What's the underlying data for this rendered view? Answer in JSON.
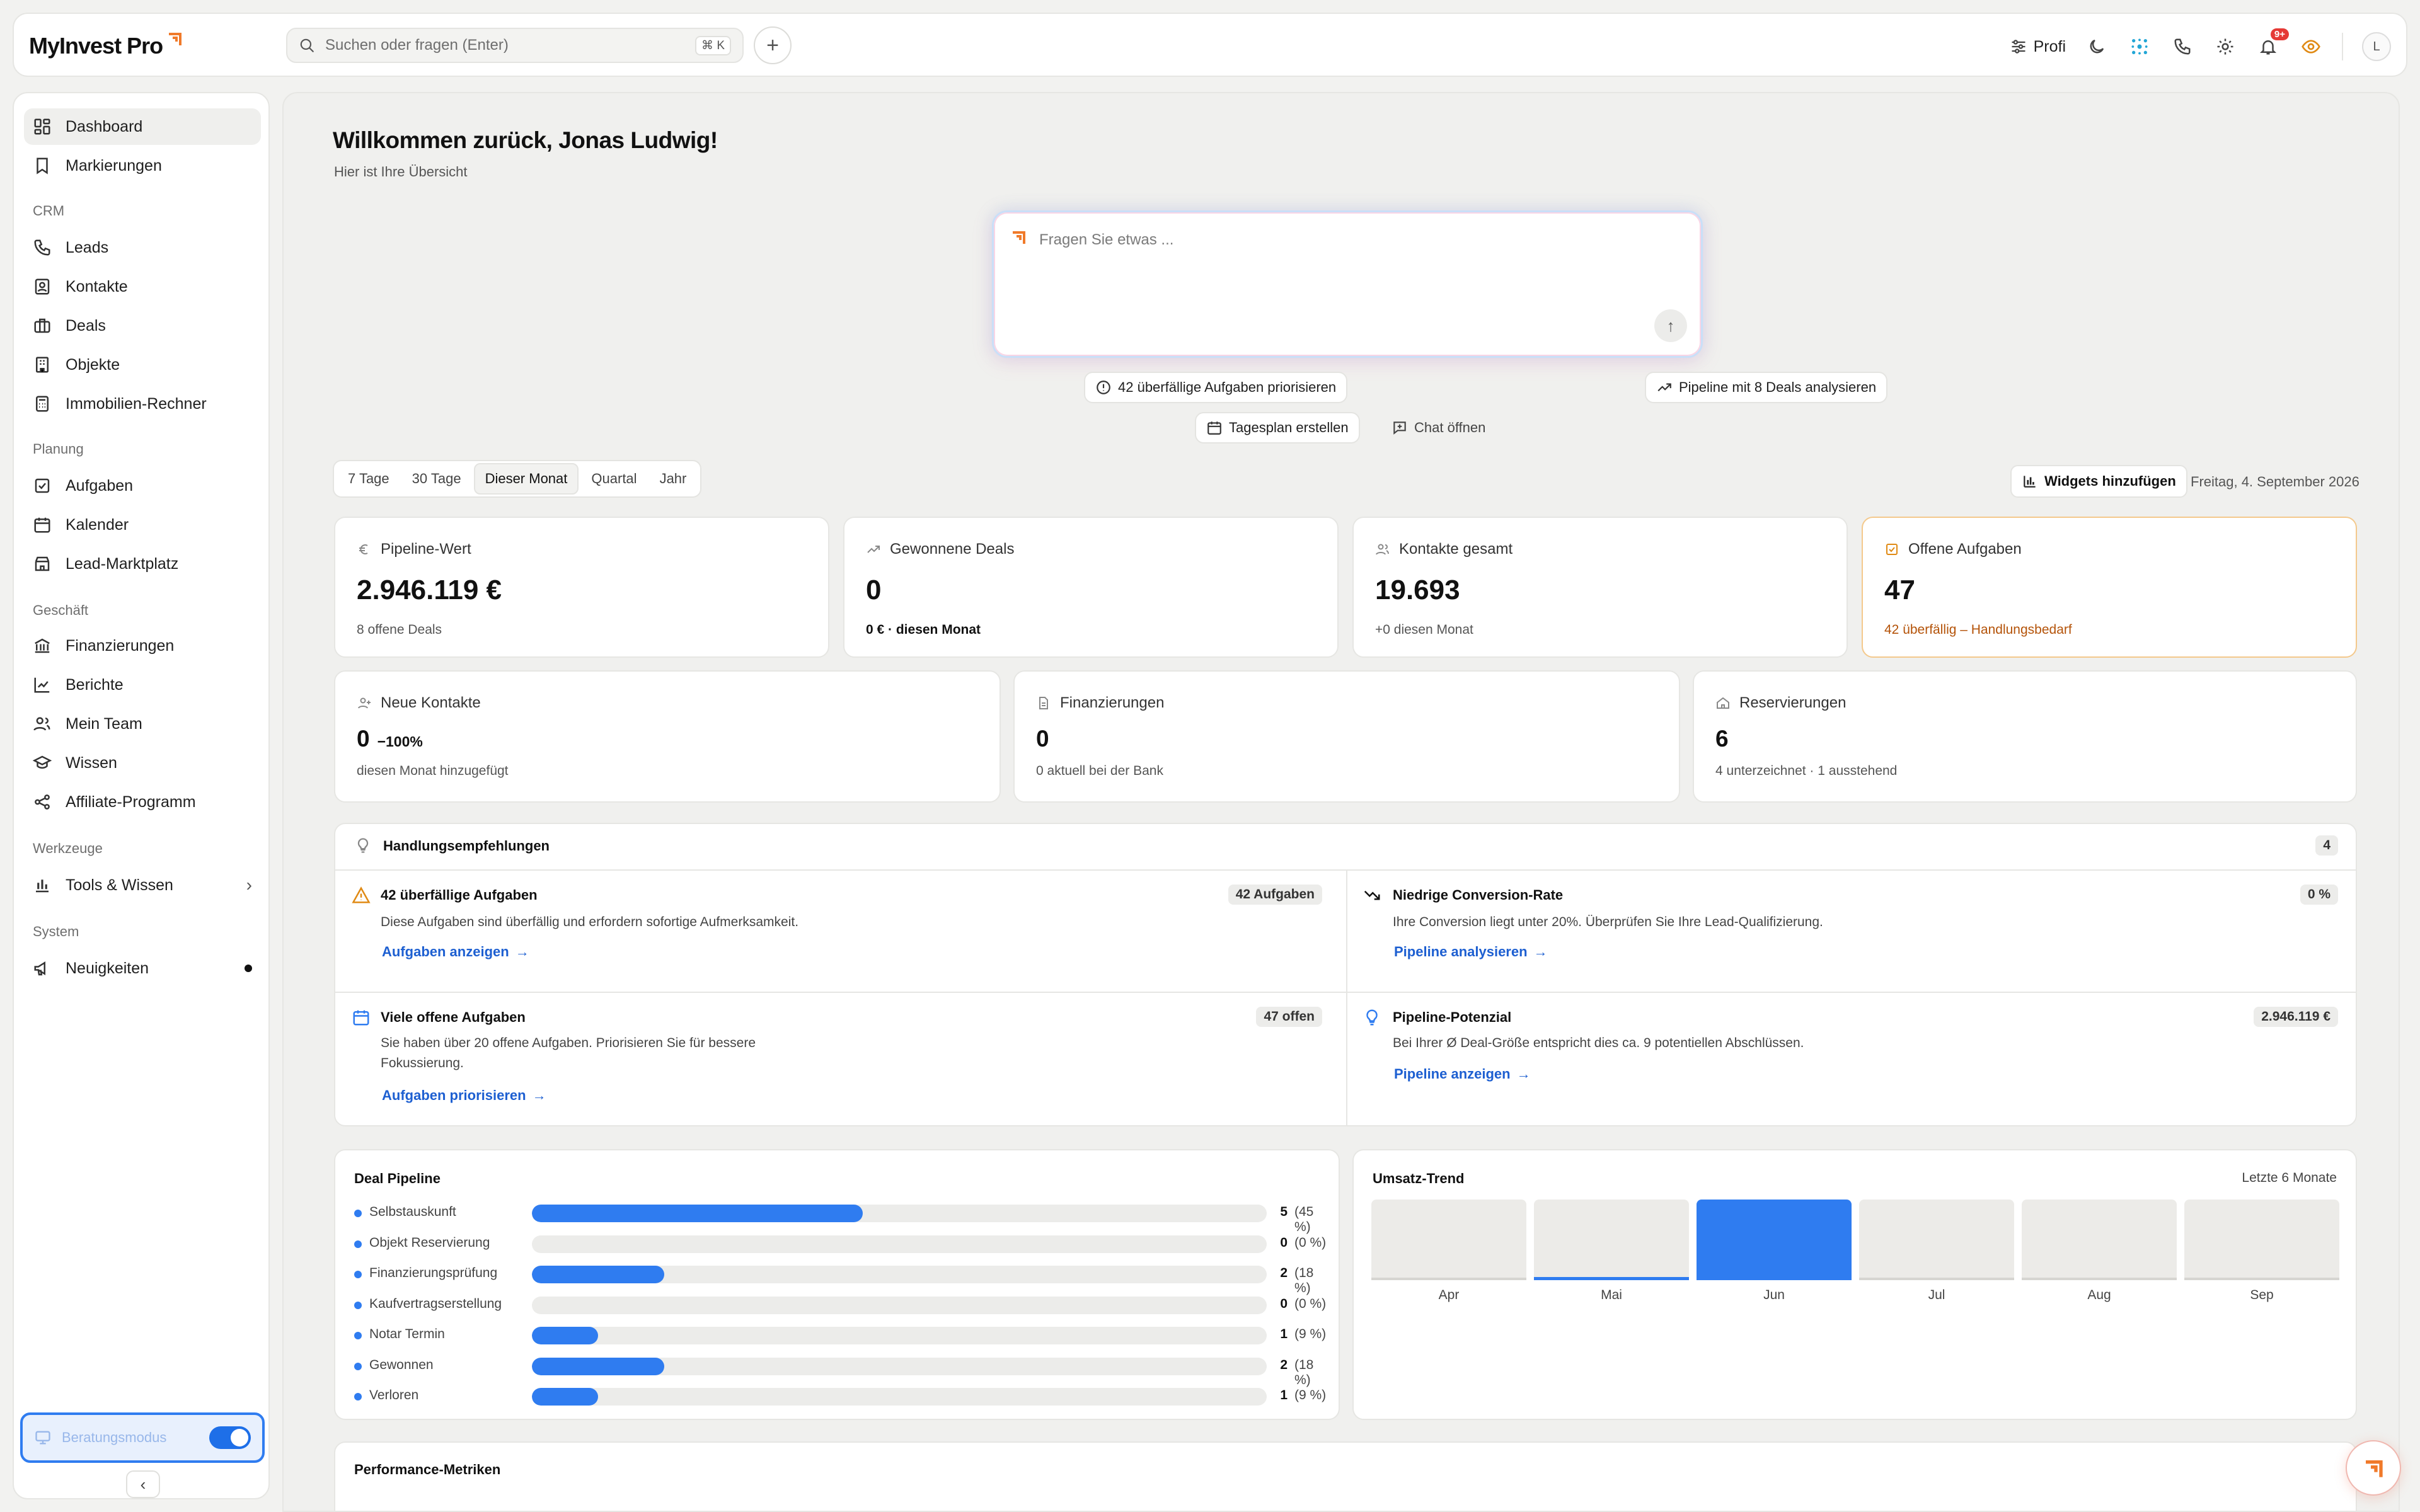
{
  "brand": {
    "name": "MyInvest Pro"
  },
  "search": {
    "placeholder": "Suchen oder fragen (Enter)",
    "shortcut": "⌘ K"
  },
  "topbar": {
    "profile_label": "Profi",
    "notification_badge": "9+",
    "avatar_initial": "L"
  },
  "sidebar": {
    "items_top": [
      {
        "label": "Dashboard",
        "icon": "dashboard-icon",
        "active": true
      },
      {
        "label": "Markierungen",
        "icon": "bookmark-icon"
      }
    ],
    "sections": [
      {
        "title": "CRM",
        "items": [
          "Leads",
          "Kontakte",
          "Deals",
          "Objekte",
          "Immobilien-Rechner"
        ]
      },
      {
        "title": "Planung",
        "items": [
          "Aufgaben",
          "Kalender",
          "Lead-Marktplatz"
        ]
      },
      {
        "title": "Geschäft",
        "items": [
          "Finanzierungen",
          "Berichte",
          "Mein Team",
          "Wissen",
          "Affiliate-Programm"
        ]
      },
      {
        "title": "Werkzeuge",
        "items": [
          "Tools & Wissen"
        ]
      },
      {
        "title": "System",
        "items": [
          "Neuigkeiten"
        ]
      }
    ],
    "mode_label": "Beratungsmodus"
  },
  "main": {
    "welcome": "Willkommen zurück, Jonas Ludwig!",
    "subtitle": "Hier ist Ihre Übersicht",
    "ask_placeholder": "Fragen Sie etwas ...",
    "chips": [
      "42 überfällige Aufgaben priorisieren",
      "Pipeline mit 8 Deals analysieren",
      "Tagesplan erstellen",
      "Chat öffnen"
    ],
    "periods": [
      "7 Tage",
      "30 Tage",
      "Dieser Monat",
      "Quartal",
      "Jahr"
    ],
    "selected_period": "Dieser Monat",
    "widgets_button": "Widgets hinzufügen",
    "date": "Freitag, 4. September 2026"
  },
  "kpis": [
    {
      "label": "Pipeline-Wert",
      "value": "2.946.119 €",
      "sub": "8 offene Deals"
    },
    {
      "label": "Gewonnene Deals",
      "value": "0",
      "sub": "0 € · diesen Monat"
    },
    {
      "label": "Kontakte gesamt",
      "value": "19.693",
      "sub": "+0 diesen Monat"
    },
    {
      "label": "Offene Aufgaben",
      "value": "47",
      "sub": "42 überfällig – Handlungsbedarf"
    }
  ],
  "kpis2": [
    {
      "label": "Neue Kontakte",
      "value": "0",
      "change": "−100%",
      "sub": "diesen Monat hinzugefügt"
    },
    {
      "label": "Finanzierungen",
      "value": "0",
      "sub": "0 aktuell bei der Bank"
    },
    {
      "label": "Reservierungen",
      "value": "6",
      "sub": "4 unterzeichnet · 1 ausstehend"
    }
  ],
  "recommendations": {
    "title": "Handlungsempfehlungen",
    "count": "4",
    "items": [
      {
        "title": "42 überfällige Aufgaben",
        "tag": "42 Aufgaben",
        "desc": "Diese Aufgaben sind überfällig und erfordern sofortige Aufmerksamkeit.",
        "link": "Aufgaben anzeigen"
      },
      {
        "title": "Niedrige Conversion-Rate",
        "tag": "0 %",
        "desc": "Ihre Conversion liegt unter 20%. Überprüfen Sie Ihre Lead-Qualifizierung.",
        "link": "Pipeline analysieren"
      },
      {
        "title": "Viele offene Aufgaben",
        "tag": "47 offen",
        "desc": "Sie haben über 20 offene Aufgaben. Priorisieren Sie für bessere Fokussierung.",
        "link": "Aufgaben priorisieren"
      },
      {
        "title": "Pipeline-Potenzial",
        "tag": "2.946.119 €",
        "desc": "Bei Ihrer Ø Deal-Größe entspricht dies ca. 9 potentiellen Abschlüssen.",
        "link": "Pipeline anzeigen"
      }
    ]
  },
  "pipeline": {
    "title": "Deal Pipeline",
    "stages": [
      {
        "label": "Selbstauskunft",
        "count": "5",
        "pct": "(45 %)",
        "fraction": 0.45
      },
      {
        "label": "Objekt Reservierung",
        "count": "0",
        "pct": "(0 %)",
        "fraction": 0
      },
      {
        "label": "Finanzierungsprüfung",
        "count": "2",
        "pct": "(18 %)",
        "fraction": 0.18
      },
      {
        "label": "Kaufvertragserstellung",
        "count": "0",
        "pct": "(0 %)",
        "fraction": 0
      },
      {
        "label": "Notar Termin",
        "count": "1",
        "pct": "(9 %)",
        "fraction": 0.09
      },
      {
        "label": "Gewonnen",
        "count": "2",
        "pct": "(18 %)",
        "fraction": 0.18
      },
      {
        "label": "Verloren",
        "count": "1",
        "pct": "(9 %)",
        "fraction": 0.09
      }
    ]
  },
  "trend": {
    "title": "Umsatz-Trend",
    "range": "Letzte 6 Monate",
    "months": [
      "Apr",
      "Mai",
      "Jun",
      "Jul",
      "Aug",
      "Sep"
    ],
    "levels": [
      0,
      0.04,
      1,
      0,
      0,
      0
    ]
  },
  "performance": {
    "title": "Performance-Metriken"
  },
  "colors": {
    "accent": "#2f7cf0",
    "brand_orange": "#f07a2a",
    "warning": "#b45309",
    "link": "#1d5fd1"
  }
}
